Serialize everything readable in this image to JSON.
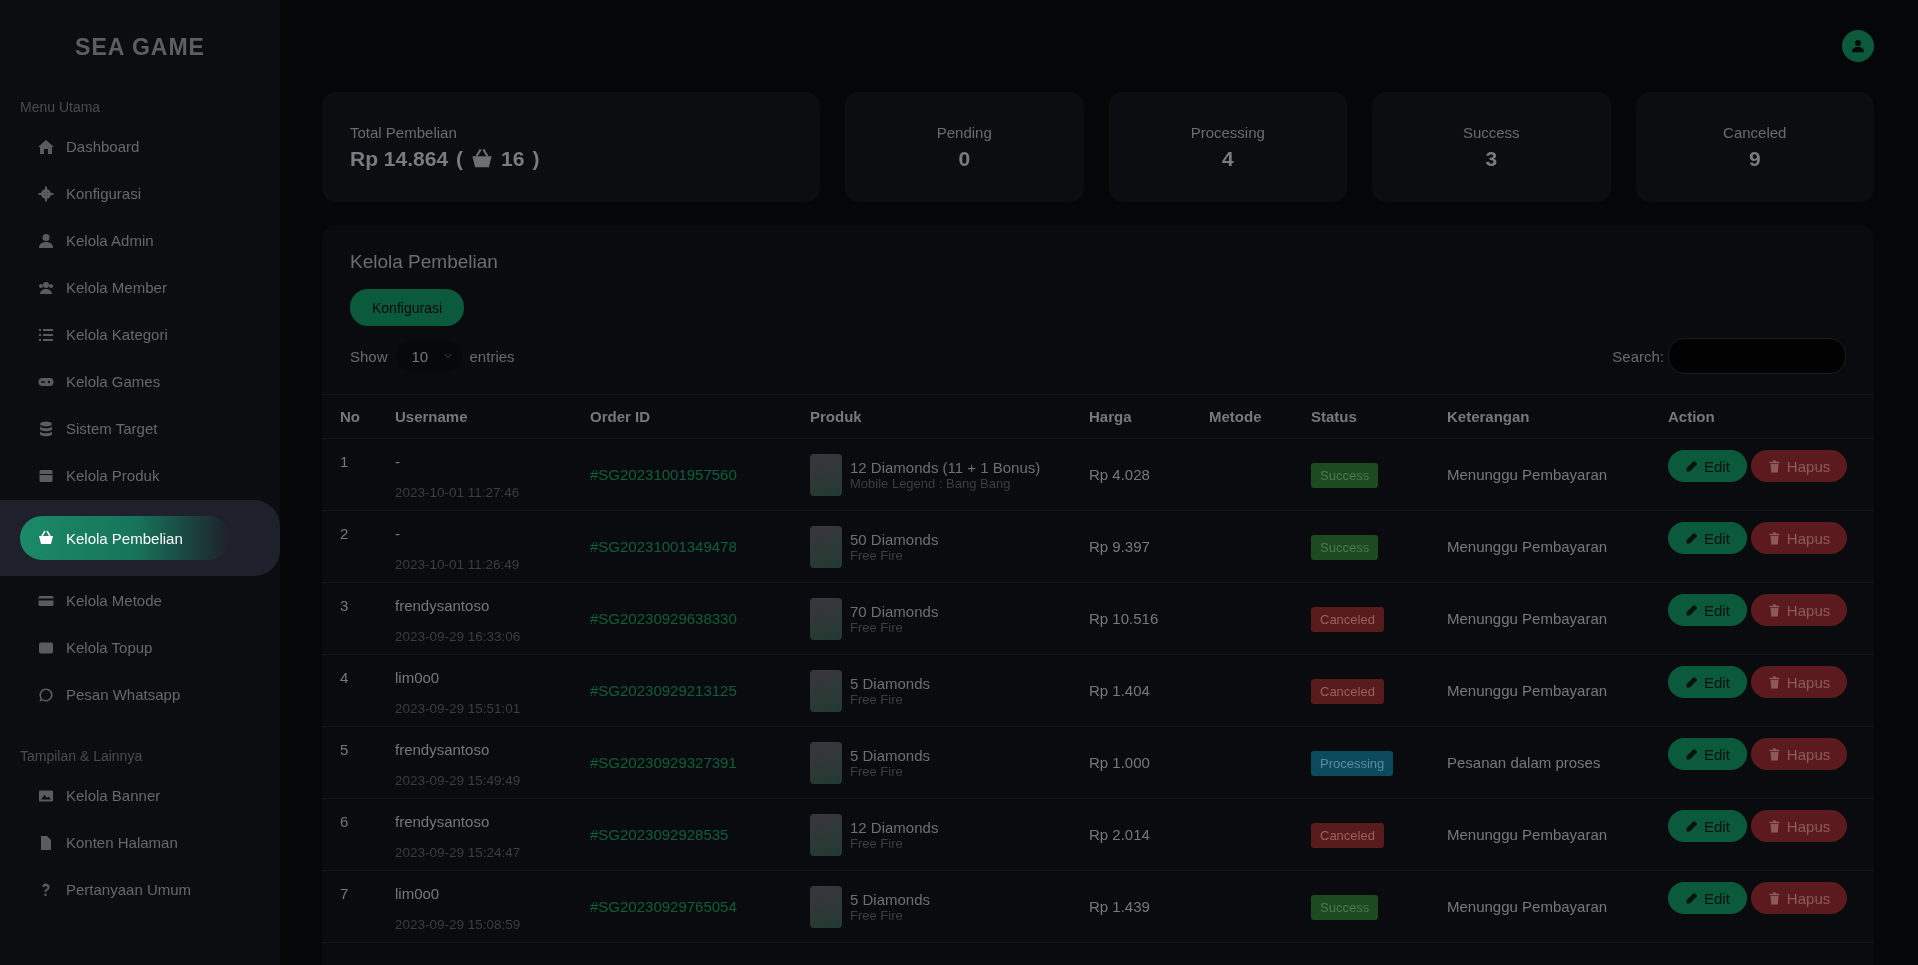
{
  "logo": "SEA GAME",
  "sidebar": {
    "sections": [
      {
        "heading": "Menu Utama",
        "items": [
          {
            "label": "Dashboard",
            "selected": false
          },
          {
            "label": "Konfigurasi",
            "selected": false
          },
          {
            "label": "Kelola Admin",
            "selected": false
          },
          {
            "label": "Kelola Member",
            "selected": false
          },
          {
            "label": "Kelola Kategori",
            "selected": false
          },
          {
            "label": "Kelola Games",
            "selected": false
          },
          {
            "label": "Sistem Target",
            "selected": false
          },
          {
            "label": "Kelola Produk",
            "selected": false
          },
          {
            "label": "Kelola Pembelian",
            "selected": true
          },
          {
            "label": "Kelola Metode",
            "selected": false
          },
          {
            "label": "Kelola Topup",
            "selected": false
          },
          {
            "label": "Pesan Whatsapp",
            "selected": false
          }
        ]
      },
      {
        "heading": "Tampilan & Lainnya",
        "items": [
          {
            "label": "Kelola Banner",
            "selected": false
          },
          {
            "label": "Konten Halaman",
            "selected": false
          },
          {
            "label": "Pertanyaan Umum",
            "selected": false
          }
        ]
      }
    ]
  },
  "stats": {
    "total": {
      "label": "Total Pembelian",
      "amount": "Rp 14.864",
      "open": "(",
      "count": "16",
      "close": ")"
    },
    "cards": [
      {
        "label": "Pending",
        "value": "0"
      },
      {
        "label": "Processing",
        "value": "4"
      },
      {
        "label": "Success",
        "value": "3"
      },
      {
        "label": "Canceled",
        "value": "9"
      }
    ]
  },
  "panel": {
    "title": "Kelola Pembelian",
    "config_button": "Konfigurasi",
    "length": {
      "show": "Show",
      "value": "10",
      "entries": "entries"
    },
    "search": {
      "label": "Search:"
    },
    "table": {
      "columns": [
        "No",
        "Username",
        "Order ID",
        "Produk",
        "Harga",
        "Metode",
        "Status",
        "Keterangan",
        "Action"
      ],
      "rows": [
        {
          "no": "1",
          "username": "-",
          "date": "2023-10-01 11:27:46",
          "order_id": "#SG20231001957560",
          "product": "12 Diamonds (11 + 1 Bonus)",
          "game": "Mobile Legend : Bang Bang",
          "price": "Rp 4.028",
          "status": {
            "label": "Success",
            "kind": "success"
          },
          "note": "Menunggu Pembayaran",
          "edit": "Edit",
          "delete": "Hapus"
        },
        {
          "no": "2",
          "username": "-",
          "date": "2023-10-01 11:26:49",
          "order_id": "#SG20231001349478",
          "product": "50 Diamonds",
          "game": "Free Fire",
          "price": "Rp 9.397",
          "status": {
            "label": "Success",
            "kind": "success"
          },
          "note": "Menunggu Pembayaran",
          "edit": "Edit",
          "delete": "Hapus"
        },
        {
          "no": "3",
          "username": "frendysantoso",
          "date": "2023-09-29 16:33:06",
          "order_id": "#SG20230929638330",
          "product": "70 Diamonds",
          "game": "Free Fire",
          "price": "Rp 10.516",
          "status": {
            "label": "Canceled",
            "kind": "canceled"
          },
          "note": "Menunggu Pembayaran",
          "edit": "Edit",
          "delete": "Hapus"
        },
        {
          "no": "4",
          "username": "lim0o0",
          "date": "2023-09-29 15:51:01",
          "order_id": "#SG20230929213125",
          "product": "5 Diamonds",
          "game": "Free Fire",
          "price": "Rp 1.404",
          "status": {
            "label": "Canceled",
            "kind": "canceled"
          },
          "note": "Menunggu Pembayaran",
          "edit": "Edit",
          "delete": "Hapus"
        },
        {
          "no": "5",
          "username": "frendysantoso",
          "date": "2023-09-29 15:49:49",
          "order_id": "#SG20230929327391",
          "product": "5 Diamonds",
          "game": "Free Fire",
          "price": "Rp 1.000",
          "status": {
            "label": "Processing",
            "kind": "processing"
          },
          "note": "Pesanan dalam proses",
          "edit": "Edit",
          "delete": "Hapus"
        },
        {
          "no": "6",
          "username": "frendysantoso",
          "date": "2023-09-29 15:24:47",
          "order_id": "#SG2023092928535",
          "product": "12 Diamonds",
          "game": "Free Fire",
          "price": "Rp 2.014",
          "status": {
            "label": "Canceled",
            "kind": "canceled"
          },
          "note": "Menunggu Pembayaran",
          "edit": "Edit",
          "delete": "Hapus"
        },
        {
          "no": "7",
          "username": "lim0o0",
          "date": "2023-09-29 15:08:59",
          "order_id": "#SG20230929765054",
          "product": "5 Diamonds",
          "game": "Free Fire",
          "price": "Rp 1.439",
          "status": {
            "label": "Success",
            "kind": "success"
          },
          "note": "Menunggu Pembayaran",
          "edit": "Edit",
          "delete": "Hapus"
        }
      ]
    }
  }
}
